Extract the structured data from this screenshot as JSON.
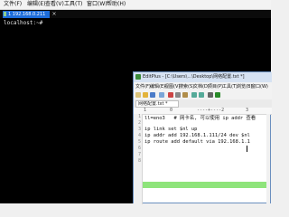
{
  "terminal": {
    "menu": [
      "文件(F)",
      "编辑(E)",
      "查看(V)",
      "工具(T)",
      "窗口(W)",
      "帮助(H)"
    ],
    "tab_label": "1 192.168.0.211",
    "tab_close": "×",
    "prompt": "localhost:~# "
  },
  "editor": {
    "title": "EditPlus - [C:\\Users\\...\\Desktop\\网络配置.txt *]",
    "menu": [
      "文件(F)",
      "编辑(E)",
      "视图(V)",
      "搜索(S)",
      "文档(D)",
      "项目(P)",
      "工具(T)",
      "浏览(B)",
      "窗口(W)"
    ],
    "file_tab": "网络配置.txt *",
    "ruler": [
      "1",
      "0",
      "----+----2",
      "3"
    ],
    "line_numbers": [
      "1",
      "2",
      "3",
      "4",
      "5",
      "6",
      "7",
      "8"
    ],
    "lines": [
      "ll=eno3   # 网卡名, 可以使用 ip addr 查看",
      "",
      "ip link set $nl up",
      "ip addr add 192.168.1.111/24 dev $nl",
      "ip route add default via 192.168.1.1",
      "",
      "",
      ""
    ]
  },
  "colors": {
    "terminal_bg": "#000000",
    "tab_active": "#1d6ddb",
    "current_line": "#8ee47b"
  }
}
